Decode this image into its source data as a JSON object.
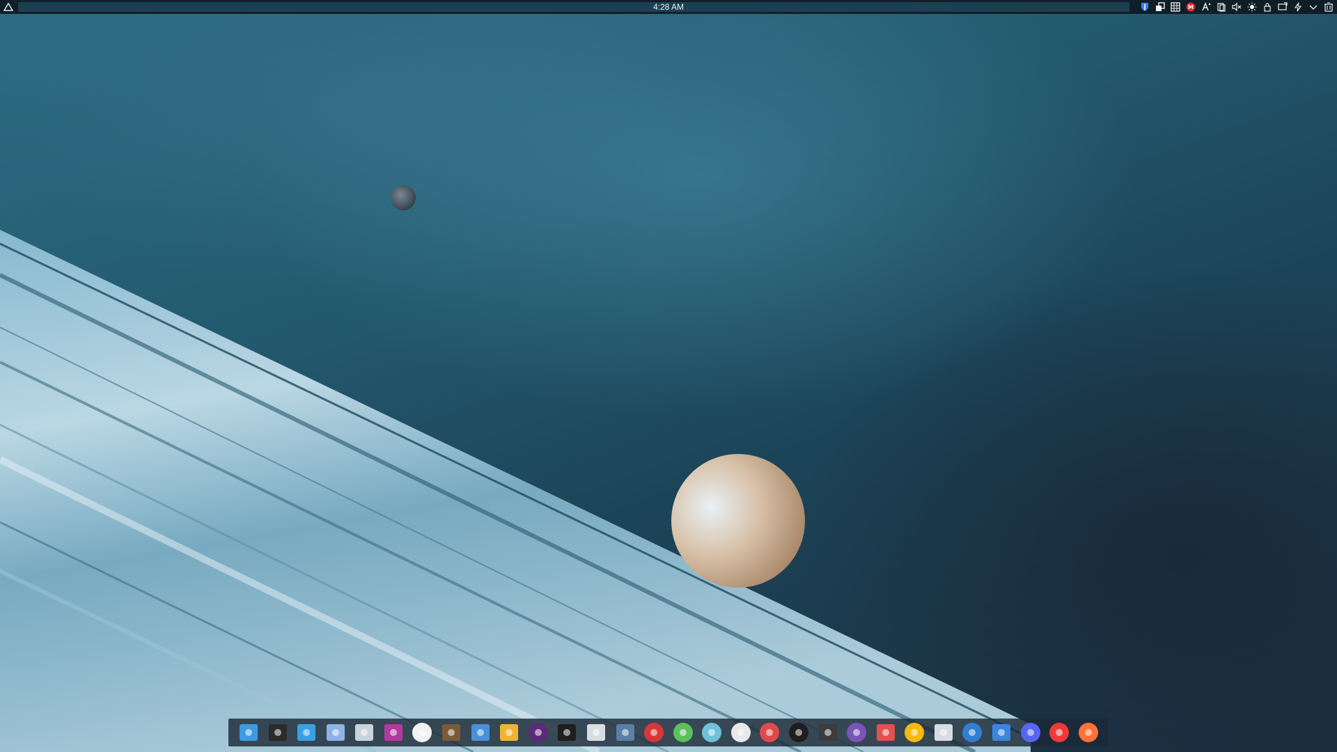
{
  "top_panel": {
    "clock": "4:28 AM",
    "launcher_icon": "kde-launcher-icon",
    "tray_icons": [
      "bitwarden-icon",
      "clipboard-icon",
      "grid-icon",
      "mega-icon",
      "input-method-icon",
      "copy-icon",
      "volume-muted-icon",
      "brightness-icon",
      "lock-icon",
      "display-icon",
      "power-icon",
      "chevron-down-icon",
      "trash-icon"
    ]
  },
  "dock": {
    "apps": [
      {
        "name": "file-manager-icon",
        "color": "#3d9be0"
      },
      {
        "name": "terminal-icon",
        "color": "#2b2b2b"
      },
      {
        "name": "text-editor-icon",
        "color": "#3aa0e6"
      },
      {
        "name": "document-viewer-icon",
        "color": "#8fb3e6"
      },
      {
        "name": "disk-usage-icon",
        "color": "#c9d3dc"
      },
      {
        "name": "color-picker-icon",
        "color": "#b03aa0"
      },
      {
        "name": "inkscape-icon",
        "color": "#f2f2f2"
      },
      {
        "name": "gimp-icon",
        "color": "#7a5a3a"
      },
      {
        "name": "grid-app-icon",
        "color": "#4a90d9"
      },
      {
        "name": "slides-icon",
        "color": "#f2b233"
      },
      {
        "name": "media-player-icon",
        "color": "#5a2b7a"
      },
      {
        "name": "system-monitor-icon",
        "color": "#1f1f1f"
      },
      {
        "name": "video-editor-icon",
        "color": "#d8dde2"
      },
      {
        "name": "screen-icon",
        "color": "#5a7fa8"
      },
      {
        "name": "lifeline-icon",
        "color": "#d93636"
      },
      {
        "name": "vector-tool-icon",
        "color": "#5cc05c"
      },
      {
        "name": "music-player-icon",
        "color": "#6fc1d9"
      },
      {
        "name": "disc-burner-icon",
        "color": "#e8e8e8"
      },
      {
        "name": "pinball-icon",
        "color": "#e04a4a"
      },
      {
        "name": "amazon-icon",
        "color": "#1e1e1e"
      },
      {
        "name": "play-icon",
        "color": "#3c3c3c"
      },
      {
        "name": "podcast-icon",
        "color": "#7a55b8"
      },
      {
        "name": "kit-icon",
        "color": "#e35050"
      },
      {
        "name": "rewards-icon",
        "color": "#f5b90f"
      },
      {
        "name": "steam-icon",
        "color": "#d6dde4"
      },
      {
        "name": "qbittorrent-icon",
        "color": "#2f7fd0"
      },
      {
        "name": "downloader-icon",
        "color": "#3b84e0"
      },
      {
        "name": "discord-icon",
        "color": "#5865f2"
      },
      {
        "name": "vivaldi-icon",
        "color": "#ef3939"
      },
      {
        "name": "firefox-icon",
        "color": "#ff7139"
      }
    ]
  }
}
